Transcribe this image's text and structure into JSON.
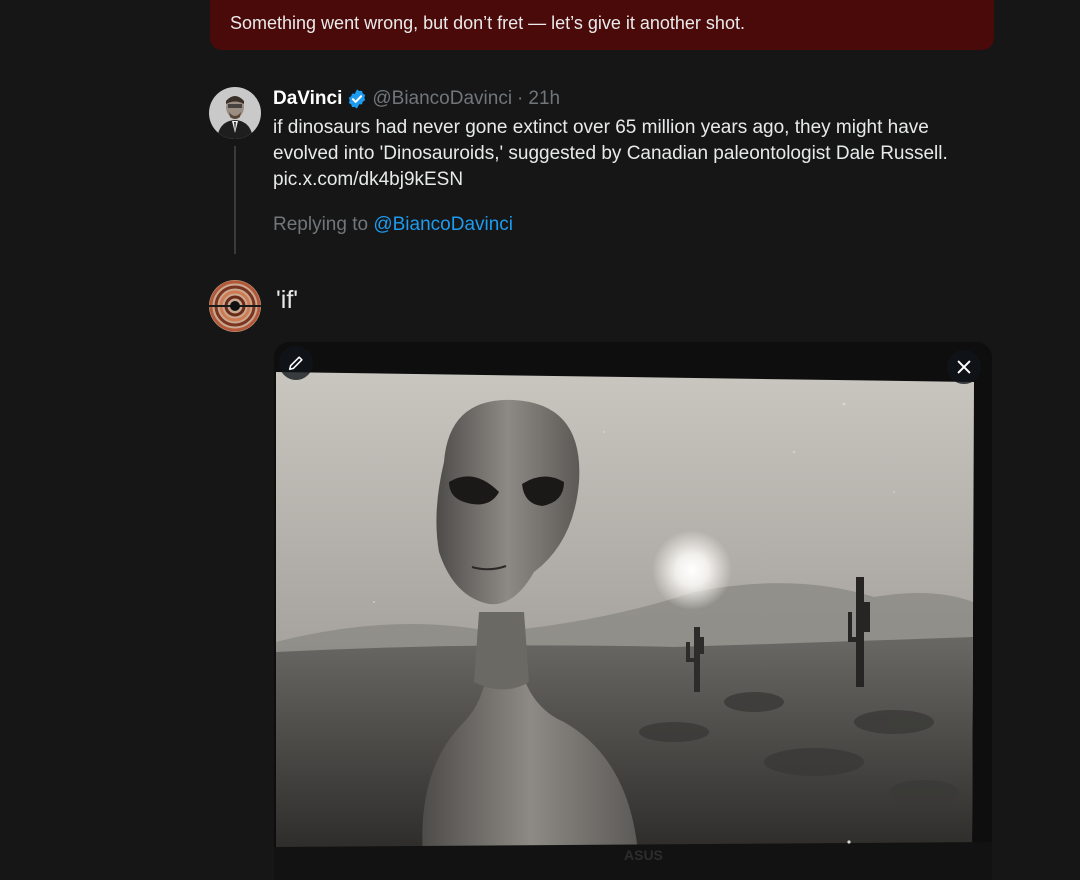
{
  "error_banner": {
    "message": "Something went wrong, but don’t fret — let’s give it another shot."
  },
  "parent_tweet": {
    "author_name": "DaVinci",
    "verified": true,
    "handle": "@BiancoDavinci",
    "separator": "·",
    "time": "21h",
    "text": "if dinosaurs had never gone extinct over 65 million years ago, they might have evolved into 'Dinosauroids,' suggested by Canadian paleontologist Dale Russell.",
    "link": "pic.x.com/dk4bj9kESN"
  },
  "reply_context": {
    "prefix": "Replying to",
    "handle": "@BiancoDavinci"
  },
  "composer": {
    "text": "'if'",
    "media": {
      "edit_icon": "pencil-icon",
      "close_icon": "close-icon",
      "monitor_brand": "ASUS"
    }
  },
  "colors": {
    "background": "#161616",
    "error_banner": "#4a0a0a",
    "link_blue": "#1d9bf0",
    "muted_text": "#71767b",
    "verified_blue": "#1d9bf0"
  }
}
